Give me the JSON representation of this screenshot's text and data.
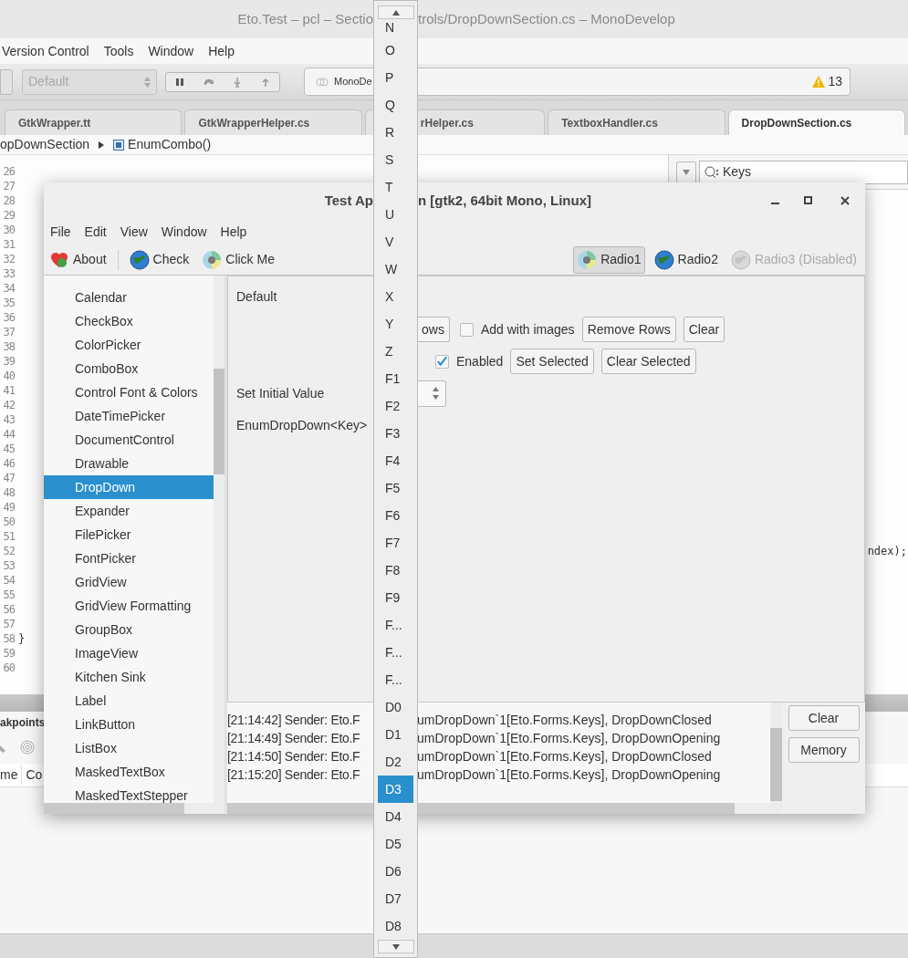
{
  "ide": {
    "title_left": "Eto.Test – pcl – Sectio",
    "title_right": "trols/DropDownSection.cs – MonoDevelop",
    "menu": [
      "Version Control",
      "Tools",
      "Window",
      "Help"
    ],
    "toolbar": {
      "config": "Default",
      "status": "MonoDe",
      "warnings": "13"
    },
    "tabs": [
      {
        "label": "GtkWrapper.tt",
        "selected": false
      },
      {
        "label": "GtkWrapperHelper.cs",
        "selected": false
      },
      {
        "label": "rHelper.cs",
        "selected": false
      },
      {
        "label": "TextboxHandler.cs",
        "selected": false
      },
      {
        "label": "DropDownSection.cs",
        "selected": true
      }
    ],
    "breadcrumb": {
      "class_name": "opDownSection",
      "member": "EnumCombo()"
    },
    "editor": {
      "lines": [
        {
          "number": "26"
        },
        {
          "number": "27"
        },
        {
          "number": "28"
        },
        {
          "number": "29"
        },
        {
          "number": "30"
        },
        {
          "number": "31"
        },
        {
          "number": "32"
        },
        {
          "number": "33"
        },
        {
          "number": "34"
        },
        {
          "number": "35"
        },
        {
          "number": "36"
        },
        {
          "number": "37"
        },
        {
          "number": "38"
        },
        {
          "number": "39"
        },
        {
          "number": "40"
        },
        {
          "number": "41"
        },
        {
          "number": "42"
        },
        {
          "number": "43"
        },
        {
          "number": "44"
        },
        {
          "number": "45"
        },
        {
          "number": "46"
        },
        {
          "number": "47"
        },
        {
          "number": "48"
        },
        {
          "number": "49"
        },
        {
          "number": "50"
        },
        {
          "number": "51"
        },
        {
          "number": "52",
          "code_right": "ndex);"
        },
        {
          "number": "53"
        },
        {
          "number": "54"
        },
        {
          "number": "55"
        },
        {
          "number": "56"
        },
        {
          "number": "57"
        },
        {
          "number": "58",
          "code": "}"
        },
        {
          "number": "59"
        },
        {
          "number": "60"
        }
      ]
    },
    "search": {
      "value": "Keys"
    },
    "pad": {
      "tab": "akpoints",
      "columns": [
        "me",
        "Co"
      ]
    }
  },
  "dialog": {
    "title_left": "Test Ap",
    "title_right": "n [gtk2, 64bit Mono, Linux]",
    "menu": [
      "File",
      "Edit",
      "View",
      "Window",
      "Help"
    ],
    "toolbar": [
      {
        "label": "About"
      },
      {
        "label": "Check"
      },
      {
        "label": "Click Me"
      }
    ],
    "radios": [
      {
        "label": "Radio1",
        "selected": true,
        "disabled": false
      },
      {
        "label": "Radio2",
        "selected": false,
        "disabled": false
      },
      {
        "label": "Radio3 (Disabled)",
        "selected": false,
        "disabled": true
      }
    ],
    "sections": [
      {
        "label": "Calendar",
        "selected": false
      },
      {
        "label": "CheckBox",
        "selected": false
      },
      {
        "label": "ColorPicker",
        "selected": false
      },
      {
        "label": "ComboBox",
        "selected": false
      },
      {
        "label": "Control Font & Colors",
        "selected": false
      },
      {
        "label": "DateTimePicker",
        "selected": false
      },
      {
        "label": "DocumentControl",
        "selected": false
      },
      {
        "label": "Drawable",
        "selected": false
      },
      {
        "label": "DropDown",
        "selected": true
      },
      {
        "label": "Expander",
        "selected": false
      },
      {
        "label": "FilePicker",
        "selected": false
      },
      {
        "label": "FontPicker",
        "selected": false
      },
      {
        "label": "GridView",
        "selected": false
      },
      {
        "label": "GridView Formatting",
        "selected": false
      },
      {
        "label": "GroupBox",
        "selected": false
      },
      {
        "label": "ImageView",
        "selected": false
      },
      {
        "label": "Kitchen Sink",
        "selected": false
      },
      {
        "label": "Label",
        "selected": false
      },
      {
        "label": "LinkButton",
        "selected": false
      },
      {
        "label": "ListBox",
        "selected": false
      },
      {
        "label": "MaskedTextBox",
        "selected": false
      },
      {
        "label": "MaskedTextStepper",
        "selected": false
      }
    ],
    "rows": [
      {
        "label": "Default"
      },
      {
        "controls": [
          {
            "kind": "button",
            "label": "ows"
          },
          {
            "kind": "checkbox",
            "label": "Add with images",
            "checked": false
          },
          {
            "kind": "button",
            "label": "Remove Rows"
          },
          {
            "kind": "button",
            "label": "Clear"
          }
        ]
      },
      {
        "controls": [
          {
            "kind": "checkbox",
            "label": "Enabled",
            "checked": true
          },
          {
            "kind": "button",
            "label": "Set Selected"
          },
          {
            "kind": "button",
            "label": "Clear Selected"
          }
        ]
      },
      {
        "label": "Set Initial Value",
        "controls": [
          {
            "kind": "spinner"
          }
        ]
      },
      {
        "label": "EnumDropDown<Key>"
      }
    ],
    "log": [
      {
        "left": "[21:14:42] Sender: Eto.F",
        "right": "umDropDown`1[Eto.Forms.Keys], DropDownClosed"
      },
      {
        "left": "[21:14:49] Sender: Eto.F",
        "right": "umDropDown`1[Eto.Forms.Keys], DropDownOpening"
      },
      {
        "left": "[21:14:50] Sender: Eto.F",
        "right": "umDropDown`1[Eto.Forms.Keys], DropDownClosed"
      },
      {
        "left": "[21:15:20] Sender: Eto.F",
        "right": "umDropDown`1[Eto.Forms.Keys], DropDownOpening"
      }
    ],
    "log_buttons": [
      "Clear",
      "Memory"
    ]
  },
  "popup": {
    "items": [
      {
        "label": "N",
        "selected": false
      },
      {
        "label": "O",
        "selected": false
      },
      {
        "label": "P",
        "selected": false
      },
      {
        "label": "Q",
        "selected": false
      },
      {
        "label": "R",
        "selected": false
      },
      {
        "label": "S",
        "selected": false
      },
      {
        "label": "T",
        "selected": false
      },
      {
        "label": "U",
        "selected": false
      },
      {
        "label": "V",
        "selected": false
      },
      {
        "label": "W",
        "selected": false
      },
      {
        "label": "X",
        "selected": false
      },
      {
        "label": "Y",
        "selected": false
      },
      {
        "label": "Z",
        "selected": false
      },
      {
        "label": "F1",
        "selected": false
      },
      {
        "label": "F2",
        "selected": false
      },
      {
        "label": "F3",
        "selected": false
      },
      {
        "label": "F4",
        "selected": false
      },
      {
        "label": "F5",
        "selected": false
      },
      {
        "label": "F6",
        "selected": false
      },
      {
        "label": "F7",
        "selected": false
      },
      {
        "label": "F8",
        "selected": false
      },
      {
        "label": "F9",
        "selected": false
      },
      {
        "label": "F...",
        "selected": false
      },
      {
        "label": "F...",
        "selected": false
      },
      {
        "label": "F...",
        "selected": false
      },
      {
        "label": "D0",
        "selected": false
      },
      {
        "label": "D1",
        "selected": false
      },
      {
        "label": "D2",
        "selected": false
      },
      {
        "label": "D3",
        "selected": true
      },
      {
        "label": "D4",
        "selected": false
      },
      {
        "label": "D5",
        "selected": false
      },
      {
        "label": "D6",
        "selected": false
      },
      {
        "label": "D7",
        "selected": false
      },
      {
        "label": "D8",
        "selected": false
      }
    ]
  }
}
